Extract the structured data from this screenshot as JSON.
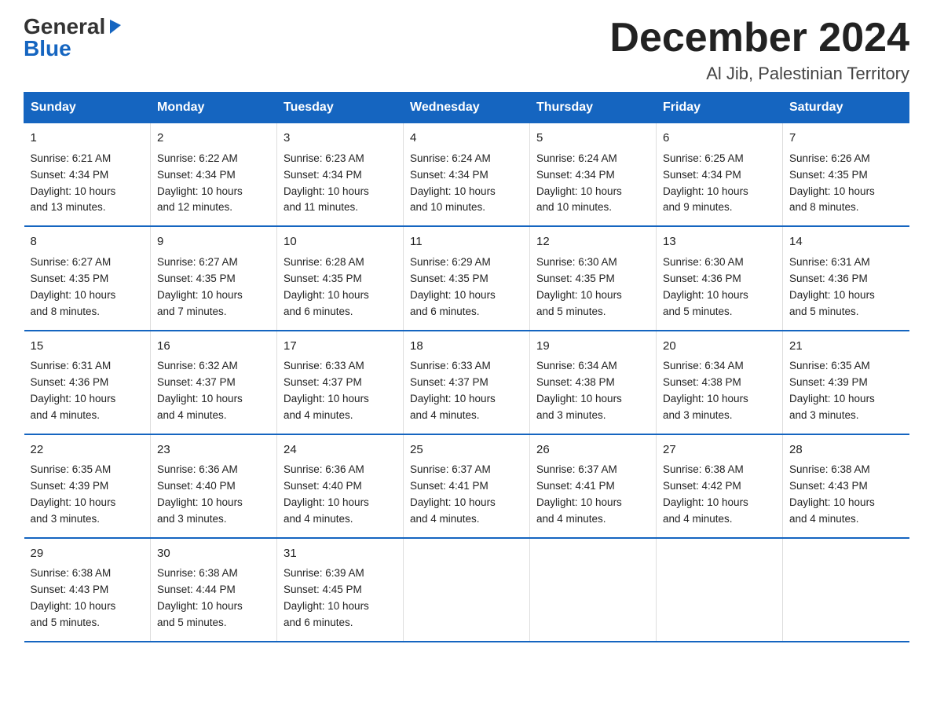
{
  "logo": {
    "general": "General",
    "blue": "Blue",
    "triangle": "▶"
  },
  "title": "December 2024",
  "subtitle": "Al Jib, Palestinian Territory",
  "days_of_week": [
    "Sunday",
    "Monday",
    "Tuesday",
    "Wednesday",
    "Thursday",
    "Friday",
    "Saturday"
  ],
  "weeks": [
    [
      {
        "day": "1",
        "info": "Sunrise: 6:21 AM\nSunset: 4:34 PM\nDaylight: 10 hours\nand 13 minutes."
      },
      {
        "day": "2",
        "info": "Sunrise: 6:22 AM\nSunset: 4:34 PM\nDaylight: 10 hours\nand 12 minutes."
      },
      {
        "day": "3",
        "info": "Sunrise: 6:23 AM\nSunset: 4:34 PM\nDaylight: 10 hours\nand 11 minutes."
      },
      {
        "day": "4",
        "info": "Sunrise: 6:24 AM\nSunset: 4:34 PM\nDaylight: 10 hours\nand 10 minutes."
      },
      {
        "day": "5",
        "info": "Sunrise: 6:24 AM\nSunset: 4:34 PM\nDaylight: 10 hours\nand 10 minutes."
      },
      {
        "day": "6",
        "info": "Sunrise: 6:25 AM\nSunset: 4:34 PM\nDaylight: 10 hours\nand 9 minutes."
      },
      {
        "day": "7",
        "info": "Sunrise: 6:26 AM\nSunset: 4:35 PM\nDaylight: 10 hours\nand 8 minutes."
      }
    ],
    [
      {
        "day": "8",
        "info": "Sunrise: 6:27 AM\nSunset: 4:35 PM\nDaylight: 10 hours\nand 8 minutes."
      },
      {
        "day": "9",
        "info": "Sunrise: 6:27 AM\nSunset: 4:35 PM\nDaylight: 10 hours\nand 7 minutes."
      },
      {
        "day": "10",
        "info": "Sunrise: 6:28 AM\nSunset: 4:35 PM\nDaylight: 10 hours\nand 6 minutes."
      },
      {
        "day": "11",
        "info": "Sunrise: 6:29 AM\nSunset: 4:35 PM\nDaylight: 10 hours\nand 6 minutes."
      },
      {
        "day": "12",
        "info": "Sunrise: 6:30 AM\nSunset: 4:35 PM\nDaylight: 10 hours\nand 5 minutes."
      },
      {
        "day": "13",
        "info": "Sunrise: 6:30 AM\nSunset: 4:36 PM\nDaylight: 10 hours\nand 5 minutes."
      },
      {
        "day": "14",
        "info": "Sunrise: 6:31 AM\nSunset: 4:36 PM\nDaylight: 10 hours\nand 5 minutes."
      }
    ],
    [
      {
        "day": "15",
        "info": "Sunrise: 6:31 AM\nSunset: 4:36 PM\nDaylight: 10 hours\nand 4 minutes."
      },
      {
        "day": "16",
        "info": "Sunrise: 6:32 AM\nSunset: 4:37 PM\nDaylight: 10 hours\nand 4 minutes."
      },
      {
        "day": "17",
        "info": "Sunrise: 6:33 AM\nSunset: 4:37 PM\nDaylight: 10 hours\nand 4 minutes."
      },
      {
        "day": "18",
        "info": "Sunrise: 6:33 AM\nSunset: 4:37 PM\nDaylight: 10 hours\nand 4 minutes."
      },
      {
        "day": "19",
        "info": "Sunrise: 6:34 AM\nSunset: 4:38 PM\nDaylight: 10 hours\nand 3 minutes."
      },
      {
        "day": "20",
        "info": "Sunrise: 6:34 AM\nSunset: 4:38 PM\nDaylight: 10 hours\nand 3 minutes."
      },
      {
        "day": "21",
        "info": "Sunrise: 6:35 AM\nSunset: 4:39 PM\nDaylight: 10 hours\nand 3 minutes."
      }
    ],
    [
      {
        "day": "22",
        "info": "Sunrise: 6:35 AM\nSunset: 4:39 PM\nDaylight: 10 hours\nand 3 minutes."
      },
      {
        "day": "23",
        "info": "Sunrise: 6:36 AM\nSunset: 4:40 PM\nDaylight: 10 hours\nand 3 minutes."
      },
      {
        "day": "24",
        "info": "Sunrise: 6:36 AM\nSunset: 4:40 PM\nDaylight: 10 hours\nand 4 minutes."
      },
      {
        "day": "25",
        "info": "Sunrise: 6:37 AM\nSunset: 4:41 PM\nDaylight: 10 hours\nand 4 minutes."
      },
      {
        "day": "26",
        "info": "Sunrise: 6:37 AM\nSunset: 4:41 PM\nDaylight: 10 hours\nand 4 minutes."
      },
      {
        "day": "27",
        "info": "Sunrise: 6:38 AM\nSunset: 4:42 PM\nDaylight: 10 hours\nand 4 minutes."
      },
      {
        "day": "28",
        "info": "Sunrise: 6:38 AM\nSunset: 4:43 PM\nDaylight: 10 hours\nand 4 minutes."
      }
    ],
    [
      {
        "day": "29",
        "info": "Sunrise: 6:38 AM\nSunset: 4:43 PM\nDaylight: 10 hours\nand 5 minutes."
      },
      {
        "day": "30",
        "info": "Sunrise: 6:38 AM\nSunset: 4:44 PM\nDaylight: 10 hours\nand 5 minutes."
      },
      {
        "day": "31",
        "info": "Sunrise: 6:39 AM\nSunset: 4:45 PM\nDaylight: 10 hours\nand 6 minutes."
      },
      null,
      null,
      null,
      null
    ]
  ]
}
